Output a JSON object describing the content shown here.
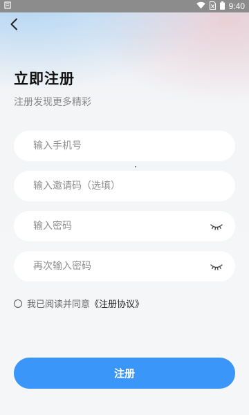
{
  "status_bar": {
    "time": "9:40",
    "icons": [
      "notification-icon",
      "wifi-icon",
      "sim-icon",
      "battery-icon"
    ]
  },
  "header": {
    "back_icon": "chevron-left-icon",
    "title": "立即注册",
    "subtitle": "注册发现更多精彩"
  },
  "form": {
    "phone_placeholder": "输入手机号",
    "invite_placeholder": "输入邀请码（选填）",
    "password_placeholder": "输入密码",
    "confirm_password_placeholder": "再次输入密码",
    "eye_icon": "eye-closed-icon"
  },
  "agreement": {
    "text": "我已阅读并同意",
    "link": "《注册协议》",
    "checked": false
  },
  "actions": {
    "register_label": "注册"
  },
  "colors": {
    "primary": "#3a96f8",
    "field_bg": "#ffffff",
    "page_bg": "#f5f6f8",
    "status_bar": "#8c8c8c"
  }
}
